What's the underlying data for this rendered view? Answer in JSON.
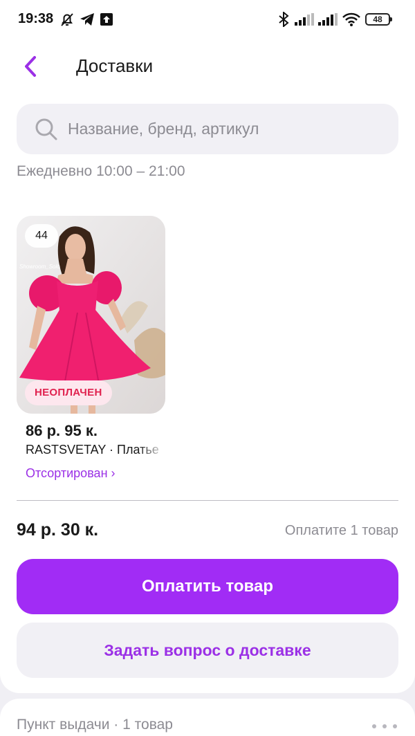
{
  "status_bar": {
    "time": "19:38",
    "battery": "48",
    "icons": [
      "alarm-off-icon",
      "telegram-icon",
      "upload-icon",
      "bluetooth-icon",
      "signal-icon",
      "signal-icon",
      "wifi-icon",
      "battery-icon"
    ]
  },
  "header": {
    "title": "Доставки",
    "back_icon": "chevron-left-icon"
  },
  "search": {
    "placeholder": "Название, бренд, артикул",
    "icon": "search-icon"
  },
  "pickup_hours": "Ежедневно 10:00 – 21:00",
  "product": {
    "size": "44",
    "status": "НЕОПЛАЧЕН",
    "price": "86 р. 95 к.",
    "brand_line": "RASTSVETAY · Платье",
    "link": "Отсортирован ›",
    "image_watermark": "Showroom_Solo"
  },
  "summary": {
    "total": "94 р. 30 к.",
    "hint": "Оплатите 1 товар"
  },
  "actions": {
    "pay_label": "Оплатить товар",
    "ask_label": "Задать вопрос о доставке"
  },
  "next_section": {
    "label": "Пункт выдачи · 1 товар"
  },
  "colors": {
    "accent": "#a12cf5",
    "accent_text": "#9b30e6",
    "status_unpaid": "#e0224f",
    "background": "#f0eff4"
  }
}
